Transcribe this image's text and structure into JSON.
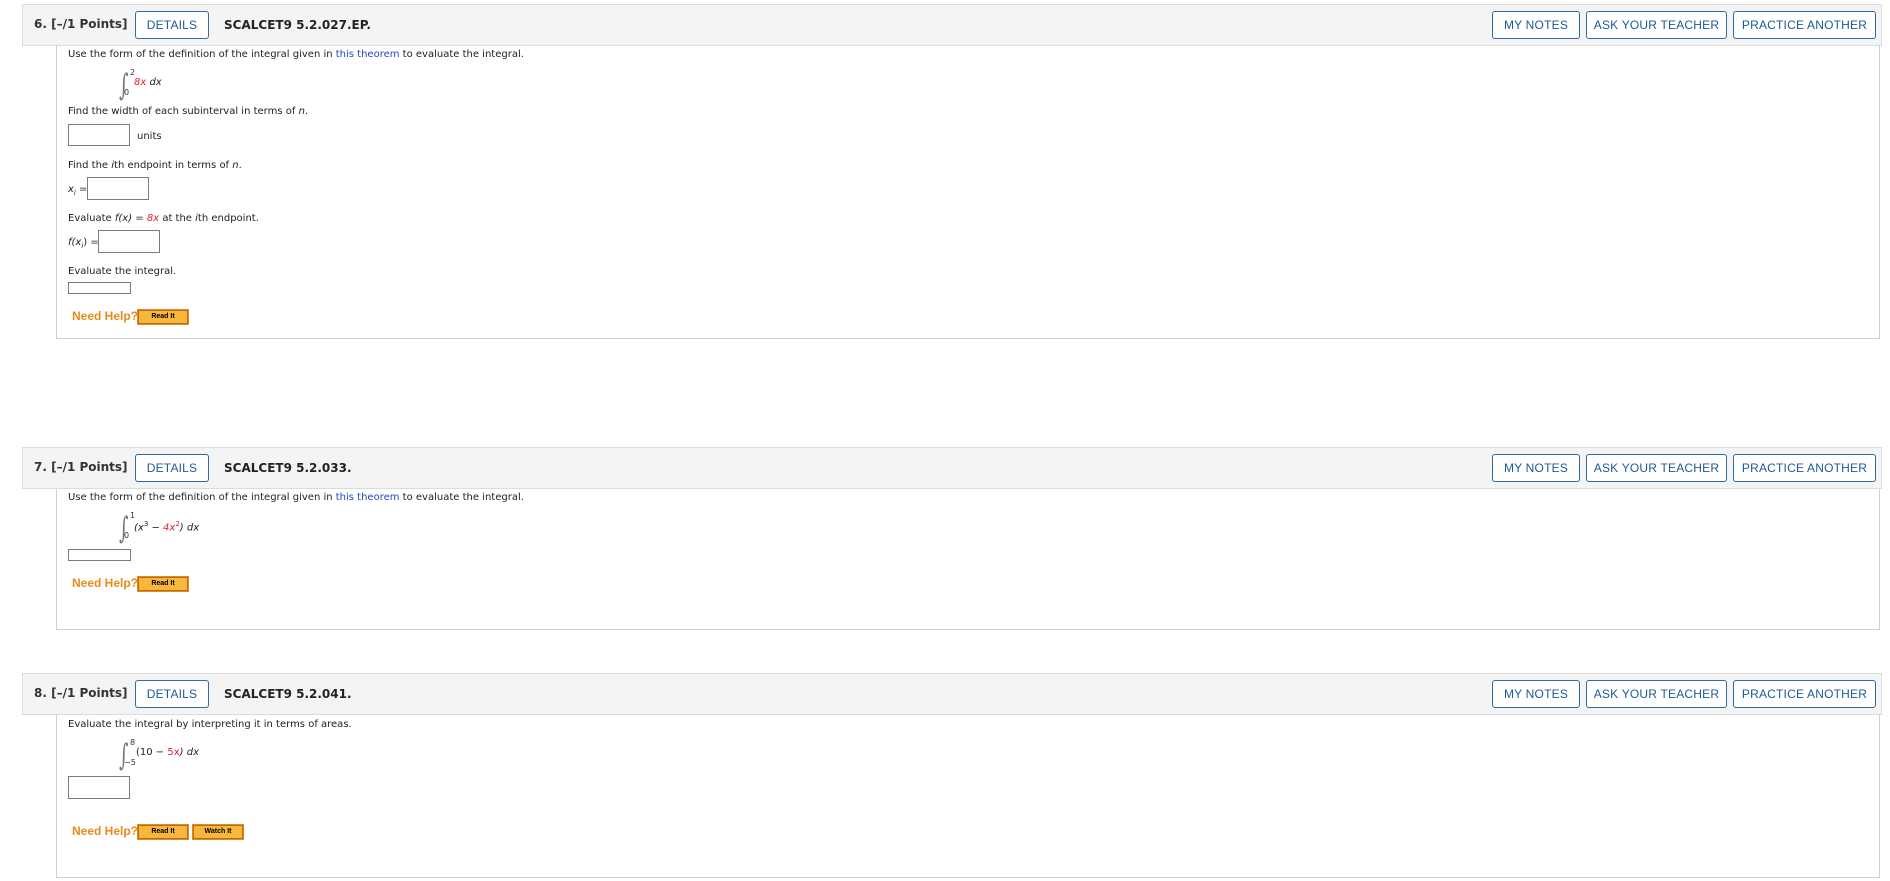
{
  "buttons": {
    "details": "DETAILS",
    "my_notes": "MY NOTES",
    "ask_teacher": "ASK YOUR TEACHER",
    "practice_another": "PRACTICE ANOTHER",
    "need_help": "Need Help?",
    "read_it": "Read It",
    "watch_it": "Watch It"
  },
  "q6": {
    "number": "6.  [–/1 Points]",
    "code": "SCALCET9 5.2.027.EP.",
    "instruction_pre": "Use the form of the definition of the integral given in ",
    "instruction_link": "this theorem",
    "instruction_post": " to evaluate the integral.",
    "lower": "0",
    "upper": "2",
    "integrand_red": "8x",
    "integrand_dx": " dx",
    "step1": "Find the width of each subinterval in terms of ",
    "step1_var": "n",
    "step1_end": ".",
    "units": "units",
    "step2_pre": "Find the ",
    "step2_i": "i",
    "step2_mid": "th endpoint in terms of ",
    "step2_var": "n",
    "step2_end": ".",
    "xi_label": "x",
    "xi_sub": "i",
    "xi_eq": " =",
    "step3_pre": "Evaluate ",
    "step3_f": "f(x) = ",
    "step3_red": "8x",
    "step3_mid": " at the ",
    "step3_i": "i",
    "step3_end": "th endpoint.",
    "fxi_label": "f(x",
    "fxi_sub": "i",
    "fxi_end": ") =",
    "step4": "Evaluate the integral."
  },
  "q7": {
    "number": "7.  [–/1 Points]",
    "code": "SCALCET9 5.2.033.",
    "instruction_pre": "Use the form of the definition of the integral given in ",
    "instruction_link": "this theorem",
    "instruction_post": " to evaluate the integral.",
    "lower": "0",
    "upper": "1",
    "integrand_open": "(x",
    "integrand_exp1": "3",
    "integrand_minus": " − ",
    "integrand_red": "4x",
    "integrand_exp2": "2",
    "integrand_close": ") dx"
  },
  "q8": {
    "number": "8.  [–/1 Points]",
    "code": "SCALCET9 5.2.041.",
    "instruction": "Evaluate the integral by interpreting it in terms of areas.",
    "lower": "−5",
    "upper": "8",
    "integrand_pre": "(10 − ",
    "integrand_red": "5x",
    "integrand_post": ") dx"
  },
  "colors": {
    "accent_blue": "#1c5a96",
    "help_orange": "#e88a1a",
    "red_var": "#d9232e",
    "link_blue": "#2a44c8"
  }
}
